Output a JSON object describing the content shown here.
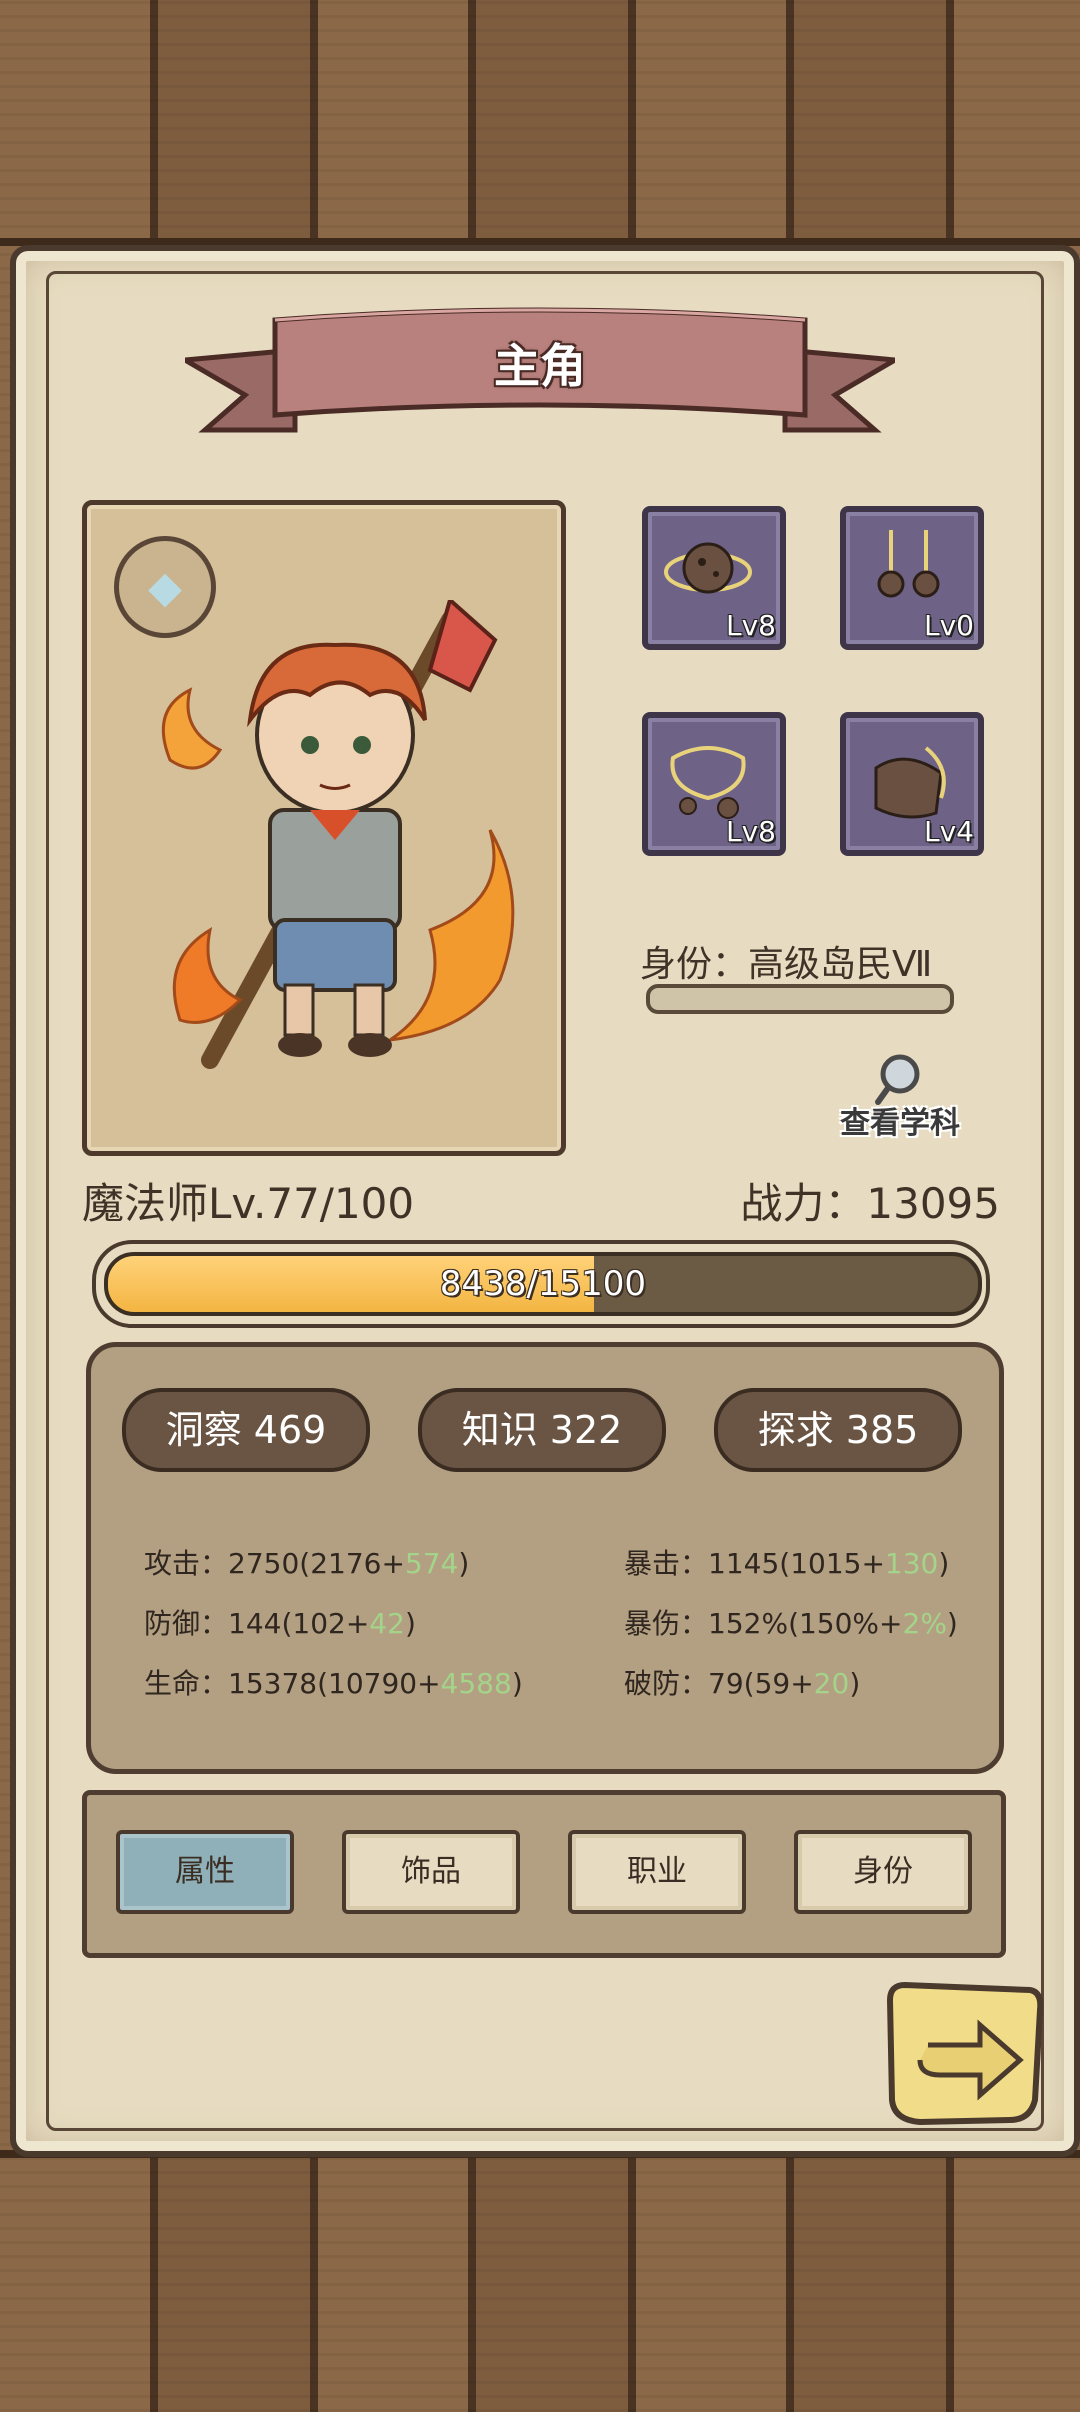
{
  "header": {
    "title": "主角"
  },
  "character": {
    "class_level": "魔法师Lv.77/100",
    "power": "战力：13095",
    "exp": {
      "text": "8438/15100",
      "current": 8438,
      "max": 15100
    }
  },
  "equipment": [
    {
      "icon": "ore-ring-icon",
      "level": "Lv8"
    },
    {
      "icon": "earrings-icon",
      "level": "Lv0"
    },
    {
      "icon": "necklace-icon",
      "level": "Lv8"
    },
    {
      "icon": "bracelet-icon",
      "level": "Lv4"
    }
  ],
  "identity": {
    "label": "身份：高级岛民Ⅶ",
    "progress": 0
  },
  "view_subject": {
    "label": "查看学科",
    "icon": "magnifier-icon"
  },
  "attributes": [
    {
      "label": "洞察 469"
    },
    {
      "label": "知识 322"
    },
    {
      "label": "探求 385"
    }
  ],
  "stats": [
    {
      "name": "攻击：",
      "base": "2750(2176+",
      "bonus": "574",
      "close": ")"
    },
    {
      "name": "防御：",
      "base": "144(102+",
      "bonus": "42",
      "close": ")"
    },
    {
      "name": "生命：",
      "base": "15378(10790+",
      "bonus": "4588",
      "close": ")"
    },
    {
      "name": "暴击：",
      "base": "1145(1015+",
      "bonus": "130",
      "close": ")"
    },
    {
      "name": "暴伤：",
      "base": "152%(150%+",
      "bonus": "2%",
      "close": ")"
    },
    {
      "name": "破防：",
      "base": "79(59+",
      "bonus": "20",
      "close": ")"
    }
  ],
  "tabs": [
    {
      "label": "属性",
      "active": true
    },
    {
      "label": "饰品",
      "active": false
    },
    {
      "label": "职业",
      "active": false
    },
    {
      "label": "身份",
      "active": false
    }
  ],
  "colors": {
    "exp_fill": "#f3b542",
    "stat_bonus": "#a4d48a",
    "active_tab": "#8fb0b8",
    "slot_bg": "#6e6386"
  }
}
